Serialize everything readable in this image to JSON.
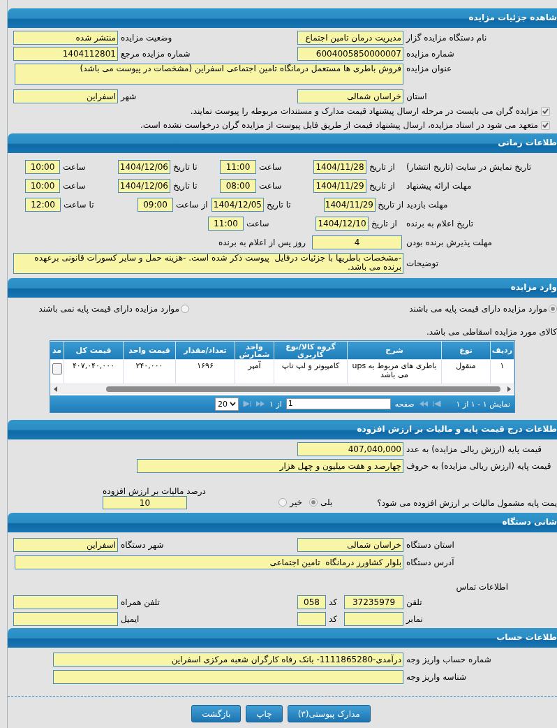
{
  "details": {
    "title": "شاهده جزئیات مزایده",
    "rows": [
      [
        {
          "label": "نام دستگاه مزایده گزار",
          "value": "مدیریت درمان تامین اجتماع"
        },
        {
          "label": "وضعیت مزایده",
          "value": "منتشر شده"
        }
      ],
      [
        {
          "label": "شماره مزایده",
          "value": "6004005850000007"
        },
        {
          "label": "شماره مزایده مرجع",
          "value": "1404112801"
        }
      ],
      [
        {
          "label": "عنوان مزایده",
          "value": "فروش باطری ها مستعمل درمانگاه تامین اجتماعی اسفراین (مشخصات در پیوست می باشد)"
        }
      ],
      [
        {
          "label": "استان",
          "value": "خراسان شمالی"
        },
        {
          "label": "شهر",
          "value": "اسفراین"
        }
      ]
    ],
    "checks": [
      {
        "label": "مزایده گران می بایست در مرحله ارسال پیشنهاد قیمت مدارک و مستندات مربوطه را پیوست نمایند.",
        "checked": true
      },
      {
        "label": "متعهد می شود در اسناد مزایده، ارسال پیشنهاد قیمت از طریق فایل پیوست از مزایده گران درخواست نشده است.",
        "checked": true
      }
    ]
  },
  "timing": {
    "title": "طلاعات زمانی",
    "rows": [
      {
        "label": "تاریخ نمایش در سایت (تاریخ انتشار)",
        "parts": [
          {
            "kind": "text",
            "text": "از تاریخ"
          },
          {
            "kind": "field",
            "text": "1404/11/28"
          },
          {
            "kind": "text",
            "text": "ساعت"
          },
          {
            "kind": "field",
            "text": "11:00"
          },
          {
            "kind": "text",
            "text": "تا تاریخ"
          },
          {
            "kind": "field",
            "text": "1404/12/06"
          },
          {
            "kind": "text",
            "text": "ساعت"
          },
          {
            "kind": "field",
            "text": "10:00"
          }
        ]
      },
      {
        "label": "مهلت ارائه پیشنهاد",
        "parts": [
          {
            "kind": "text",
            "text": "از تاریخ"
          },
          {
            "kind": "field",
            "text": "1404/11/29"
          },
          {
            "kind": "text",
            "text": "ساعت"
          },
          {
            "kind": "field",
            "text": "08:00"
          },
          {
            "kind": "text",
            "text": "تا تاریخ"
          },
          {
            "kind": "field",
            "text": "1404/12/06"
          },
          {
            "kind": "text",
            "text": "ساعت"
          },
          {
            "kind": "field",
            "text": "10:00"
          }
        ]
      },
      {
        "label": "مهلت بازدید",
        "parts": [
          {
            "kind": "text",
            "text": "از تاریخ"
          },
          {
            "kind": "field",
            "text": "1404/11/29"
          },
          {
            "kind": "text",
            "text": "تا تاریخ"
          },
          {
            "kind": "field",
            "text": "1404/12/05"
          },
          {
            "kind": "text",
            "text": "از ساعت"
          },
          {
            "kind": "field",
            "text": "09:00"
          },
          {
            "kind": "text",
            "text": "تا ساعت"
          },
          {
            "kind": "field",
            "text": "12:00"
          }
        ]
      },
      {
        "label": "تاریخ اعلام به برنده",
        "parts": [
          {
            "kind": "text",
            "text": "از تاریخ"
          },
          {
            "kind": "field",
            "text": "1404/12/10"
          },
          {
            "kind": "text",
            "text": "ساعت"
          },
          {
            "kind": "field",
            "text": "11:00"
          }
        ]
      },
      {
        "label": "مهلت پذیرش برنده بودن",
        "parts": [
          {
            "kind": "field",
            "text": "4"
          },
          {
            "kind": "text",
            "text": "روز پس از اعلام به برنده"
          }
        ]
      }
    ],
    "notes": {
      "label": "توضیحات",
      "value": "-مشخصات باطریها با جزئیات درفایل  پیوست ذکر شده است. -هزینه حمل و سایر کسورات قانونی برعهده برنده می باشد."
    }
  },
  "items": {
    "title": "وارد مزایده",
    "filters": [
      {
        "label": "موارد مزایده دارای قیمت پایه می باشند",
        "selected": true
      },
      {
        "label": "موارد مزایده دارای قیمت پایه نمی باشند",
        "selected": false
      }
    ],
    "note": "کالای مورد مزایده اسقاطی می باشد.",
    "table": {
      "columns": [
        "ردیف",
        "نوع",
        "شرح",
        "گروه کالا/نوع کاربری",
        "واحد شمارش",
        "تعداد/مقدار",
        "قیمت واحد",
        "قیمت کل",
        "مد"
      ],
      "rows": [
        [
          "۱",
          "منقول",
          "باطری های مربوط به ups می باشد",
          "کامپیوتر و لپ تاپ",
          "آمپر",
          "۱۶۹۶",
          "۲۴۰,۰۰۰",
          "۴۰۷,۰۴۰,۰۰۰"
        ]
      ]
    },
    "pager": {
      "summary": "نمایش ۱ - ۱ از ۱",
      "page_label": "صفحه",
      "page": "1",
      "page_count": "از ۱",
      "page_size": "20"
    }
  },
  "price": {
    "title": "طلاعات درج قیمت پایه و مالیات بر ارزش افزوده",
    "fields": [
      {
        "label": "قیمت پایه (ارزش ریالی مزایده) به عدد",
        "value": "407,040,000"
      },
      {
        "label": "قیمت پایه (ارزش ریالی مزایده) به حروف",
        "value": "چهارصد و هفت میلیون و چهل هزار"
      }
    ],
    "vat_question": "یمت پایه مشمول مالیات بر ارزش افزوده می شود؟",
    "options": [
      {
        "label": "بلی",
        "selected": true
      },
      {
        "label": "خیر",
        "selected": false
      }
    ],
    "vat_percent": {
      "label": "درصد مالیات بر ارزش افزوده",
      "value": "10"
    }
  },
  "address": {
    "title": "شانی دستگاه",
    "rows": [
      [
        {
          "label": "استان دستگاه",
          "value": "خراسان شمالی"
        },
        {
          "label": "شهر دستگاه",
          "value": "اسفراین"
        }
      ],
      [
        {
          "label": "آدرس دستگاه",
          "value": "بلوار کشاورز درمانگاه  تامین اجتماعی"
        }
      ]
    ],
    "contact_title": "اطلاعات تماس",
    "contact_rows": [
      {
        "label": "تلفن",
        "value": "37235979",
        "code_label": "کد",
        "code": "058",
        "second_label": "تلفن همراه"
      },
      {
        "label": "نمابر",
        "code_label": "کد",
        "second_label": "ایمیل"
      }
    ]
  },
  "account": {
    "title": "طلاعات حساب",
    "rows": [
      {
        "label": "شماره حساب واریز وجه",
        "value": "درآمدی-1111865280- بانک رفاه کارگران شعبه مرکزی اسفراین"
      },
      {
        "label": "شناسه واریز وجه"
      }
    ]
  },
  "buttons": [
    "مدارک پیوستی(۳)",
    "چاپ",
    "بازگشت"
  ]
}
